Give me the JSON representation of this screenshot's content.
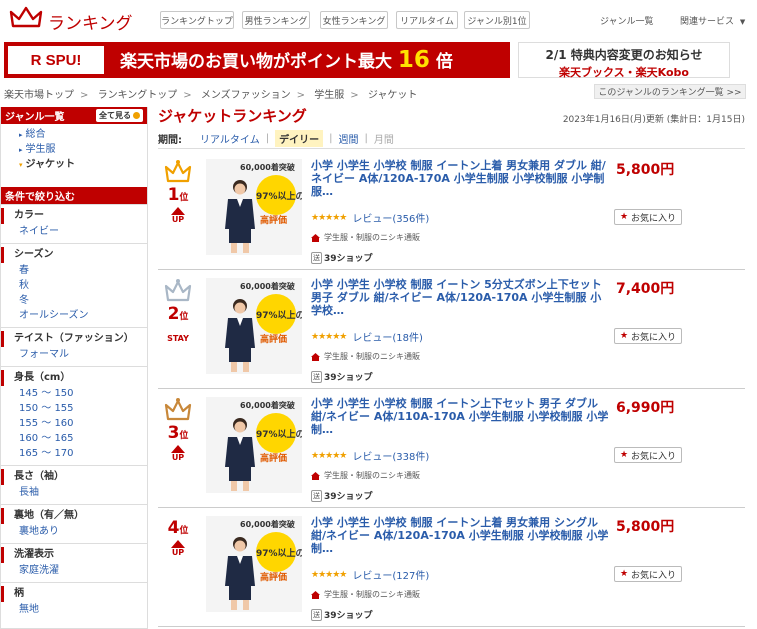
{
  "header": {
    "logo_text": "ランキング",
    "nav": [
      "ランキングトップ",
      "男性ランキング",
      "女性ランキング",
      "リアルタイム",
      "ジャンル別1位"
    ],
    "genre_list": "ジャンル一覧",
    "related_services": "関連サービス"
  },
  "banners": {
    "spu_label": "R SPU!",
    "spu_message": "楽天市場のお買い物がポイント最大",
    "spu_number": "16",
    "spu_suffix": "倍",
    "notice_line1": "2/1 特典内容変更のお知らせ",
    "notice_line2": "楽天ブックス・楽天Kobo"
  },
  "breadcrumb": [
    "楽天市場トップ",
    "ランキングトップ",
    "メンズファッション",
    "学生服",
    "ジャケット"
  ],
  "genre_ranking_list_link": "このジャンルのランキング一覧 >>",
  "sidebar": {
    "genre_header": "ジャンル一覧",
    "see_all": "全て見る",
    "genre_items": [
      {
        "label": "総合",
        "current": false
      },
      {
        "label": "学生服",
        "current": false
      },
      {
        "label": "ジャケット",
        "current": true
      }
    ],
    "filter_header": "条件で絞り込む",
    "sections": [
      {
        "title": "カラー",
        "items": [
          "ネイビー"
        ]
      },
      {
        "title": "シーズン",
        "items": [
          "春",
          "秋",
          "冬",
          "オールシーズン"
        ]
      },
      {
        "title": "テイスト（ファッション）",
        "items": [
          "フォーマル"
        ]
      },
      {
        "title": "身長（cm）",
        "items": [
          "145 〜 150",
          "150 〜 155",
          "155 〜 160",
          "160 〜 165",
          "165 〜 170"
        ]
      },
      {
        "title": "長さ（袖）",
        "items": [
          "長袖"
        ]
      },
      {
        "title": "裏地（有／無）",
        "items": [
          "裏地あり"
        ]
      },
      {
        "title": "洗濯表示",
        "items": [
          "家庭洗濯"
        ]
      },
      {
        "title": "柄",
        "items": [
          "無地"
        ]
      }
    ]
  },
  "main": {
    "title": "ジャケットランキング",
    "updated": "2023年1月16日(月)更新 (集計日：1月15日)",
    "period_label": "期間:",
    "periods": [
      {
        "label": "リアルタイム",
        "active": false
      },
      {
        "label": "デイリー",
        "active": true
      },
      {
        "label": "週間",
        "active": false
      },
      {
        "label": "月間",
        "active": false
      }
    ],
    "rows": [
      {
        "rank": "1",
        "rank_suffix": "位",
        "trend": "UP",
        "title": "小学 小学生 小学校 制服 イートン上着 男女兼用 ダブル 紺/ネイビー A体/120A-170A 小学生制服 小学校制服 小学制服…",
        "price": "5,800円",
        "review": "レビュー(356件)",
        "tag": "学生服・制服のニシキ通販",
        "shop": "39ショップ",
        "fav": "お気に入り",
        "thumb_top": "60,000着突破",
        "thumb_97": "97%以上の",
        "thumb_eval": "高評価"
      },
      {
        "rank": "2",
        "rank_suffix": "位",
        "trend": "STAY",
        "title": "小学 小学生 小学校 制服 イートン 5分丈ズボン上下セット 男子 ダブル 紺/ネイビー A体/120A-170A 小学生制服 小学校…",
        "price": "7,400円",
        "review": "レビュー(18件)",
        "tag": "学生服・制服のニシキ通販",
        "shop": "39ショップ",
        "fav": "お気に入り",
        "thumb_top": "60,000着突破",
        "thumb_97": "97%以上の",
        "thumb_eval": "高評価"
      },
      {
        "rank": "3",
        "rank_suffix": "位",
        "trend": "UP",
        "title": "小学 小学生 小学校 制服 イートン上下セット 男子 ダブル 紺/ネイビー A体/110A-170A 小学生制服 小学校制服 小学制…",
        "price": "6,990円",
        "review": "レビュー(338件)",
        "tag": "学生服・制服のニシキ通販",
        "shop": "39ショップ",
        "fav": "お気に入り",
        "thumb_top": "60,000着突破",
        "thumb_97": "97%以上の",
        "thumb_eval": "高評価"
      },
      {
        "rank": "4",
        "rank_suffix": "位",
        "trend": "UP",
        "title": "小学 小学生 小学校 制服 イートン上着 男女兼用 シングル 紺/ネイビー A体/120A-170A 小学生制服 小学校制服 小学制…",
        "price": "5,800円",
        "review": "レビュー(127件)",
        "tag": "学生服・制服のニシキ通販",
        "shop": "39ショップ",
        "fav": "お気に入り",
        "thumb_top": "60,000着突破",
        "thumb_97": "97%以上の",
        "thumb_eval": "高評価"
      }
    ]
  },
  "colors": {
    "brand": "#bf0000",
    "link": "#2a5caa",
    "gold": "#f0a000",
    "silver": "#a9b7c6",
    "bronze": "#c8883a"
  }
}
